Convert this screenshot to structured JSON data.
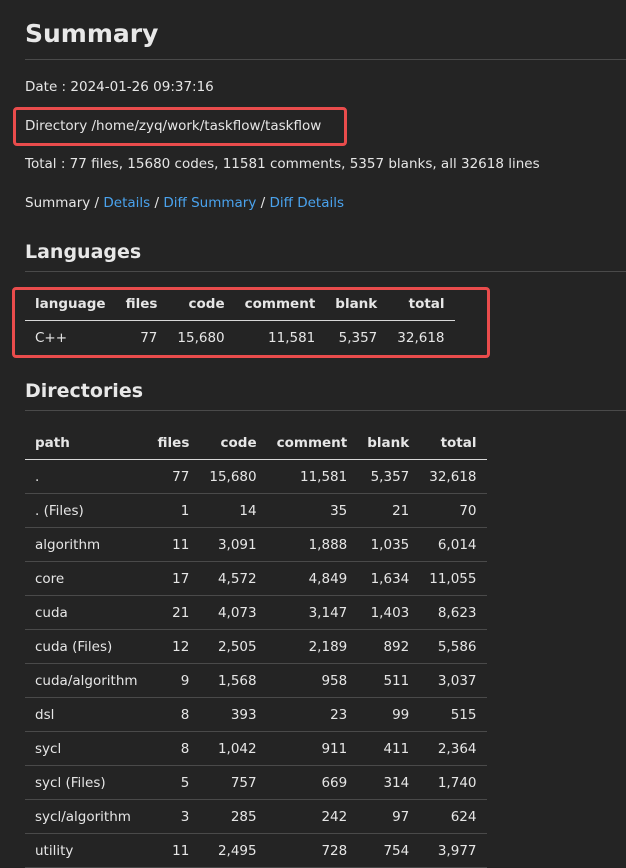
{
  "page_title": "Summary",
  "date_text": "Date : 2024-01-26 09:37:16",
  "directory_text": "Directory /home/zyq/work/taskflow/taskflow",
  "total_text": "Total : 77 files, 15680 codes, 11581 comments, 5357 blanks, all 32618 lines",
  "nav": {
    "current": "Summary",
    "sep": " / ",
    "links": [
      "Details",
      "Diff Summary",
      "Diff Details"
    ]
  },
  "colors": {
    "background": "#242424",
    "link": "#4aa3ee",
    "highlight_border": "#e94c4c"
  },
  "languages": {
    "title": "Languages",
    "headers": [
      "language",
      "files",
      "code",
      "comment",
      "blank",
      "total"
    ],
    "rows": [
      [
        "C++",
        "77",
        "15,680",
        "11,581",
        "5,357",
        "32,618"
      ]
    ]
  },
  "directories": {
    "title": "Directories",
    "headers": [
      "path",
      "files",
      "code",
      "comment",
      "blank",
      "total"
    ],
    "rows": [
      [
        ".",
        "77",
        "15,680",
        "11,581",
        "5,357",
        "32,618"
      ],
      [
        ". (Files)",
        "1",
        "14",
        "35",
        "21",
        "70"
      ],
      [
        "algorithm",
        "11",
        "3,091",
        "1,888",
        "1,035",
        "6,014"
      ],
      [
        "core",
        "17",
        "4,572",
        "4,849",
        "1,634",
        "11,055"
      ],
      [
        "cuda",
        "21",
        "4,073",
        "3,147",
        "1,403",
        "8,623"
      ],
      [
        "cuda (Files)",
        "12",
        "2,505",
        "2,189",
        "892",
        "5,586"
      ],
      [
        "cuda/algorithm",
        "9",
        "1,568",
        "958",
        "511",
        "3,037"
      ],
      [
        "dsl",
        "8",
        "393",
        "23",
        "99",
        "515"
      ],
      [
        "sycl",
        "8",
        "1,042",
        "911",
        "411",
        "2,364"
      ],
      [
        "sycl (Files)",
        "5",
        "757",
        "669",
        "314",
        "1,740"
      ],
      [
        "sycl/algorithm",
        "3",
        "285",
        "242",
        "97",
        "624"
      ],
      [
        "utility",
        "11",
        "2,495",
        "728",
        "754",
        "3,977"
      ]
    ]
  }
}
